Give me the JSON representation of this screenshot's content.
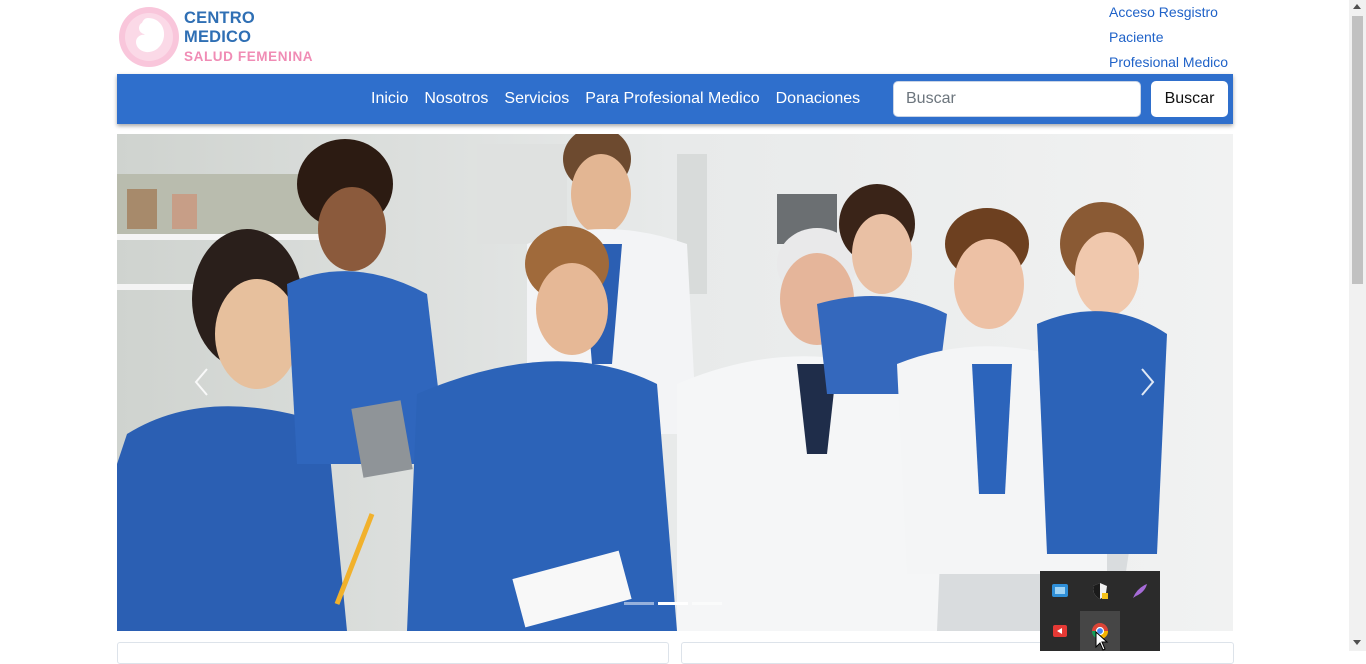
{
  "header": {
    "logo_line1": "CENTRO MEDICO",
    "logo_line2": "SALUD FEMENINA",
    "top_links": [
      "Acceso Resgistro",
      "Paciente",
      "Profesional Medico"
    ]
  },
  "nav": {
    "items": [
      "Inicio",
      "Nosotros",
      "Servicios",
      "Para Profesional Medico",
      "Donaciones"
    ],
    "search_placeholder": "Buscar",
    "search_button": "Buscar"
  },
  "carousel": {
    "image": "photo of medical students in blue scrubs with a senior doctor looking at a laptop",
    "prev_icon": "chevron-left-icon",
    "next_icon": "chevron-right-icon",
    "indicator_count": 3,
    "active_indicator": 2
  },
  "tray": {
    "icons": [
      "network-app-icon",
      "security-shield-icon",
      "feather-icon",
      "red-app-icon",
      "chrome-icon"
    ]
  },
  "colors": {
    "brand_blue": "#2f6fcc",
    "logo_blue": "#2f6fb4",
    "logo_pink": "#f08cb5",
    "link_blue": "#1f62c8"
  }
}
